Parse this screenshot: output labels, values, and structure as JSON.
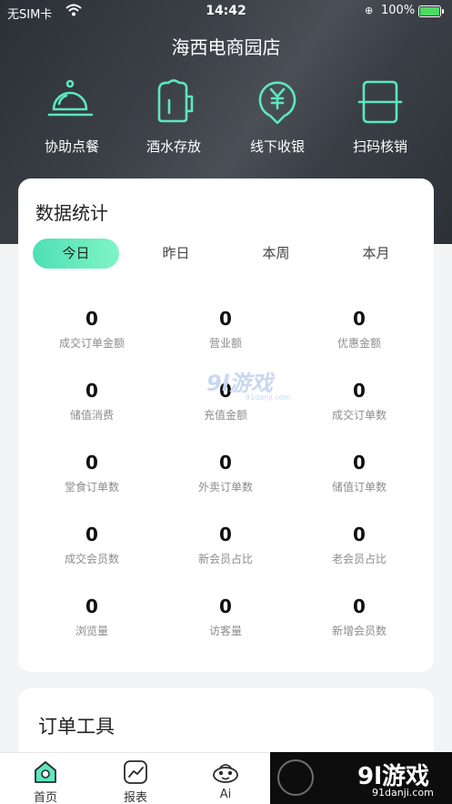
{
  "status_bar": {
    "carrier": "无SIM卡",
    "time": "14:42",
    "battery": "100%"
  },
  "store": {
    "name": "海西电商园店"
  },
  "quick_actions": [
    {
      "label": "协助点餐",
      "icon": "cloche-icon"
    },
    {
      "label": "酒水存放",
      "icon": "beer-mug-icon"
    },
    {
      "label": "线下收银",
      "icon": "yuan-coin-pin-icon"
    },
    {
      "label": "扫码核销",
      "icon": "scan-icon"
    }
  ],
  "stats_card": {
    "title": "数据统计",
    "tabs": [
      "今日",
      "昨日",
      "本周",
      "本月"
    ],
    "active_tab": "今日",
    "items": [
      {
        "value": "0",
        "label": "成交订单金额"
      },
      {
        "value": "0",
        "label": "营业额"
      },
      {
        "value": "0",
        "label": "优惠金额"
      },
      {
        "value": "0",
        "label": "储值消费"
      },
      {
        "value": "0",
        "label": "充值金额"
      },
      {
        "value": "0",
        "label": "成交订单数"
      },
      {
        "value": "0",
        "label": "堂食订单数"
      },
      {
        "value": "0",
        "label": "外卖订单数"
      },
      {
        "value": "0",
        "label": "储值订单数"
      },
      {
        "value": "0",
        "label": "成交会员数"
      },
      {
        "value": "0",
        "label": "新会员占比"
      },
      {
        "value": "0",
        "label": "老会员占比"
      },
      {
        "value": "0",
        "label": "浏览量"
      },
      {
        "value": "0",
        "label": "访客量"
      },
      {
        "value": "0",
        "label": "新增会员数"
      }
    ]
  },
  "order_tools": {
    "title": "订单工具"
  },
  "watermark": {
    "logo": "9l游戏",
    "site": "91danji.com"
  },
  "tab_bar": [
    {
      "label": "首页",
      "icon": "home-icon"
    },
    {
      "label": "报表",
      "icon": "report-chart-icon"
    },
    {
      "label": "Ai",
      "icon": "ai-bot-icon"
    }
  ],
  "brand_banner": {
    "name": "9l游戏",
    "site": "91danji.com"
  },
  "colors": {
    "accent": "#5de8bd",
    "hero_bg": "#3a3f46",
    "card_bg": "#ffffff",
    "page_bg": "#f3f4f6"
  }
}
